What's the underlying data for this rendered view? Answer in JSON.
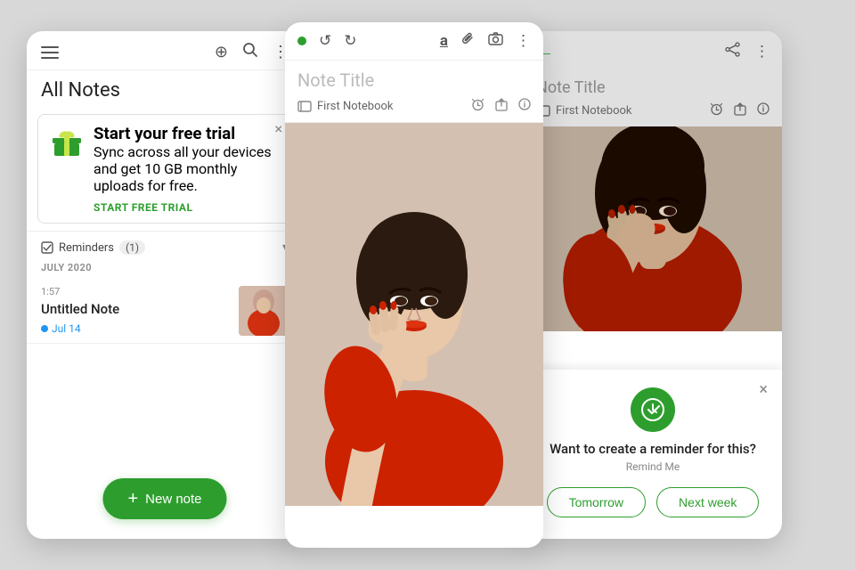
{
  "app": {
    "bg_color": "#d8d8d8"
  },
  "left_phone": {
    "header": {
      "menu_icon": "☰",
      "bolt_icon": "⊕",
      "search_icon": "🔍",
      "more_icon": "⋮"
    },
    "all_notes_title": "All Notes",
    "trial_banner": {
      "title": "Start your free trial",
      "description": "Sync across all your devices and get 10 GB monthly uploads for free.",
      "cta": "START FREE TRIAL",
      "close": "×"
    },
    "reminders": {
      "label": "Reminders",
      "count": "(1)",
      "chevron": "▾"
    },
    "date_label": "JULY 2020",
    "note": {
      "time": "1:57",
      "title": "Untitled Note",
      "tag": "Jul 14"
    },
    "new_note_button": "New note",
    "plus": "+"
  },
  "mid_phone": {
    "header": {
      "undo_icon": "↺",
      "redo_icon": "↻",
      "text_icon": "a",
      "attach_icon": "🖇",
      "camera_icon": "📷",
      "more_icon": "⋮"
    },
    "note_title_placeholder": "Note Title",
    "notebook": {
      "name": "First Notebook",
      "alarm_icon": "🔔",
      "share_icon": "⬜",
      "info_icon": "ⓘ"
    }
  },
  "right_phone": {
    "header": {
      "back_icon": "←",
      "share_icon": "⬆",
      "more_icon": "⋮"
    },
    "note_title_placeholder": "Note Title",
    "notebook": {
      "name": "First Notebook",
      "alarm_icon": "🔔",
      "share_icon": "⬜",
      "info_icon": "ⓘ"
    },
    "reminder_popup": {
      "question": "Want to create a reminder for this?",
      "remind_me": "Remind Me",
      "close": "×",
      "btn_tomorrow": "Tomorrow",
      "btn_next_week": "Next week"
    }
  }
}
